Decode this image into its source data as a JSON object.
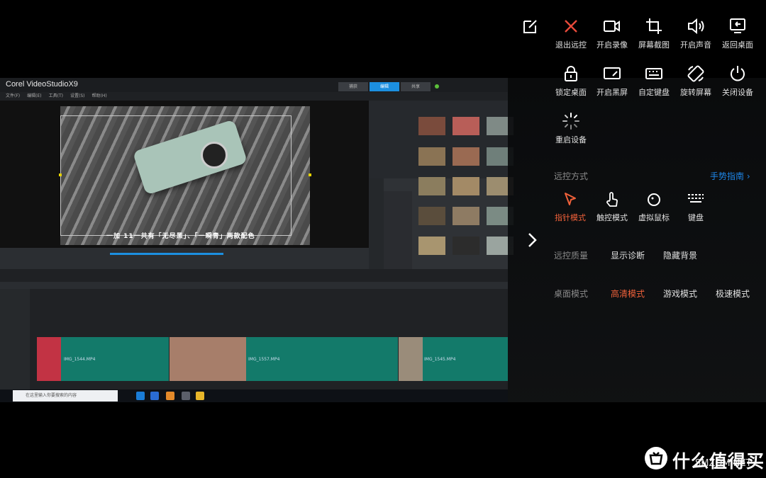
{
  "video_app": {
    "title": "Corel VideoStudioX9",
    "tabs": [
      "捕获",
      "编辑",
      "共享"
    ],
    "active_tab": "编辑",
    "menu": [
      "文件(F)",
      "编辑(E)",
      "工具(T)",
      "设置(S)",
      "帮助(H)"
    ],
    "subtitle": "一加 11一共有「无尽黑」、「一瞬青」两款配色",
    "clips": [
      "IMG_1544.MP4",
      "IMG_1557.MP4",
      "IMG_1545.MP4"
    ],
    "taskbar_search": "在这里输入你要搜索的内容"
  },
  "toolbar": {
    "row1": [
      {
        "icon": "edit-icon",
        "label": ""
      },
      {
        "icon": "close-icon",
        "label": "退出远控"
      },
      {
        "icon": "record-icon",
        "label": "开启录像"
      },
      {
        "icon": "crop-icon",
        "label": "屏幕截图"
      },
      {
        "icon": "volume-icon",
        "label": "开启声音"
      },
      {
        "icon": "return-desktop-icon",
        "label": "返回桌面"
      }
    ],
    "row2": [
      {
        "icon": "lock-icon",
        "label": "锁定桌面"
      },
      {
        "icon": "blackscreen-icon",
        "label": "开启黑屏"
      },
      {
        "icon": "keyboard-icon",
        "label": "自定键盘"
      },
      {
        "icon": "rotate-icon",
        "label": "旋转屏幕"
      },
      {
        "icon": "power-icon",
        "label": "关闭设备"
      }
    ],
    "row3": [
      {
        "icon": "restart-icon",
        "label": "重启设备"
      }
    ]
  },
  "remote_mode": {
    "title": "远控方式",
    "guide_link": "手势指南 ›",
    "options": [
      {
        "icon": "pointer-icon",
        "label": "指针模式",
        "selected": true
      },
      {
        "icon": "touch-icon",
        "label": "触控模式",
        "selected": false
      },
      {
        "icon": "virtual-mouse-icon",
        "label": "虚拟鼠标",
        "selected": false
      },
      {
        "icon": "keyboard-mode-icon",
        "label": "键盘",
        "selected": false
      }
    ]
  },
  "quality": {
    "title": "远控质量",
    "options": [
      "显示诊断",
      "隐藏背景"
    ]
  },
  "display_mode": {
    "options": [
      {
        "label": "桌面模式",
        "selected": false
      },
      {
        "label": "高清模式",
        "selected": true
      },
      {
        "label": "游戏模式",
        "selected": false
      },
      {
        "label": "极速模式",
        "selected": false
      }
    ]
  },
  "colors": {
    "accent": "#f0613a",
    "close_red": "#e84a3a",
    "link_blue": "#1e86e8"
  },
  "watermark": {
    "text": "什么值得买",
    "sub": "SMZDM.NET"
  }
}
